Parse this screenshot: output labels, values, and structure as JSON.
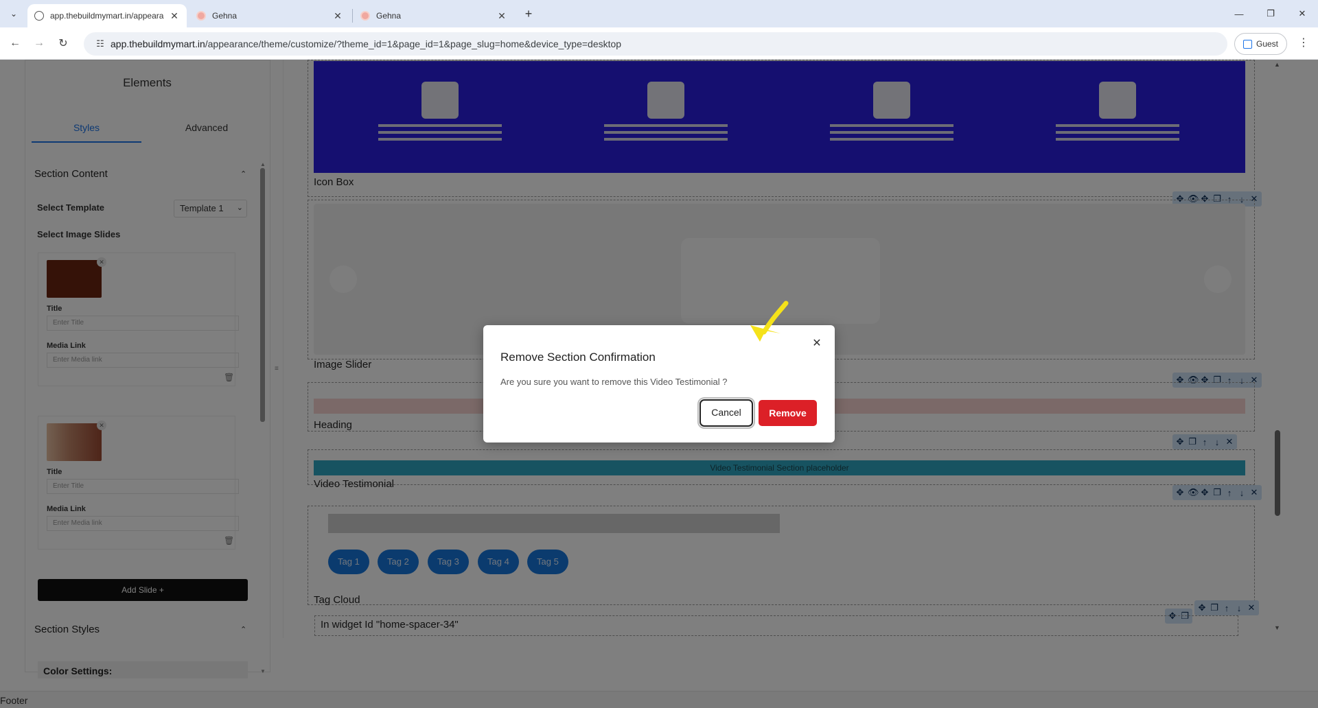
{
  "browser": {
    "tabs": [
      {
        "title": "app.thebuildmymart.in/appeara",
        "active": true
      },
      {
        "title": "Gehna",
        "active": false
      },
      {
        "title": "Gehna",
        "active": false
      }
    ],
    "url_host": "app.thebuildmymart.in",
    "url_path": "/appearance/theme/customize/?theme_id=1&page_id=1&page_slug=home&device_type=desktop",
    "profile_label": "Guest",
    "icons": {
      "tab_search": "chevron-down-icon",
      "close": "close-icon",
      "new_tab": "plus-icon",
      "back": "arrow-left-icon",
      "forward": "arrow-right-icon",
      "reload": "reload-icon",
      "site_info": "tune-icon",
      "menu": "kebab-icon"
    }
  },
  "panel": {
    "title": "Elements",
    "tabs": [
      "Styles",
      "Advanced"
    ],
    "section_content": "Section Content",
    "select_template_label": "Select Template",
    "template_value": "Template 1",
    "select_image_slides_label": "Select Image Slides",
    "slides": [
      {
        "title_label": "Title",
        "title_placeholder": "Enter Title",
        "media_label": "Media Link",
        "media_placeholder": "Enter Media link"
      },
      {
        "title_label": "Title",
        "title_placeholder": "Enter Title",
        "media_label": "Media Link",
        "media_placeholder": "Enter Media link"
      }
    ],
    "add_slide": "Add Slide +",
    "section_styles": "Section Styles",
    "color_settings": "Color Settings:"
  },
  "canvas": {
    "sections": [
      "Icon Box",
      "Image Slider",
      "Heading",
      "Video Testimonial",
      "Tag Cloud"
    ],
    "video_bar_text": "Video Testimonial Section placeholder",
    "tags": [
      "Tag 1",
      "Tag 2",
      "Tag 3",
      "Tag 4",
      "Tag 5"
    ],
    "widget_note": "In widget Id \"home-spacer-34\"",
    "footer_label": "Footer",
    "colors": {
      "icon_banner": "#2a1fe0",
      "heading_bar": "#f7d2d0",
      "video_bar": "#2fa7c3",
      "tag": "#1676dc"
    }
  },
  "modal": {
    "title": "Remove Section Confirmation",
    "message": "Are you sure you want to remove this Video Testimonial ?",
    "cancel": "Cancel",
    "remove": "Remove",
    "remove_color": "#dc2027"
  }
}
